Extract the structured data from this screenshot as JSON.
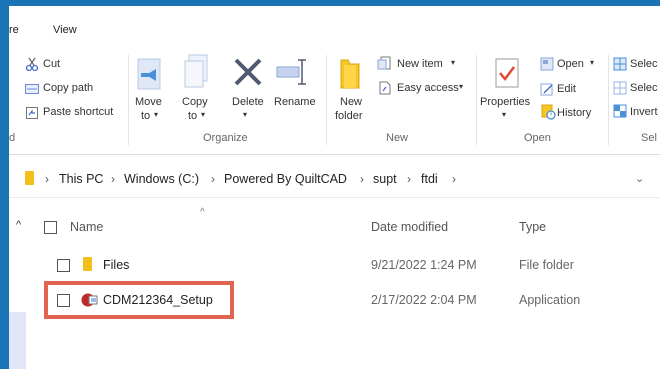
{
  "tabs": {
    "share": "re",
    "view": "View"
  },
  "ribbon": {
    "clipboard": {
      "cut": "Cut",
      "copy_path": "Copy path",
      "paste_shortcut": "Paste shortcut"
    },
    "organize": {
      "move_to": "Move",
      "move_to2": "to",
      "copy_to": "Copy",
      "copy_to2": "to",
      "delete": "Delete",
      "rename": "Rename",
      "group_label": "Organize"
    },
    "new": {
      "new_folder": "New",
      "new_folder2": "folder",
      "new_item": "New item",
      "easy_access": "Easy access",
      "group_label": "New"
    },
    "open": {
      "properties": "Properties",
      "open": "Open",
      "edit": "Edit",
      "history": "History",
      "group_label": "Open"
    },
    "select": {
      "select_all": "Selec",
      "select_none": "Selec",
      "invert": "Invert",
      "group_label": "Sel"
    },
    "left_group_label": "d"
  },
  "address": {
    "crumbs": [
      "This PC",
      "Windows (C:)",
      "Powered By QuiltCAD",
      "supt",
      "ftdi"
    ]
  },
  "columns": {
    "name": "Name",
    "date": "Date modified",
    "type": "Type"
  },
  "files": [
    {
      "name": "Files",
      "date": "9/21/2022 1:24 PM",
      "type": "File folder"
    },
    {
      "name": "CDM212364_Setup",
      "date": "2/17/2022 2:04 PM",
      "type": "Application"
    }
  ],
  "colors": {
    "frame": "#1a73b5",
    "highlight": "#e0644f",
    "folder": "#f3c019"
  }
}
